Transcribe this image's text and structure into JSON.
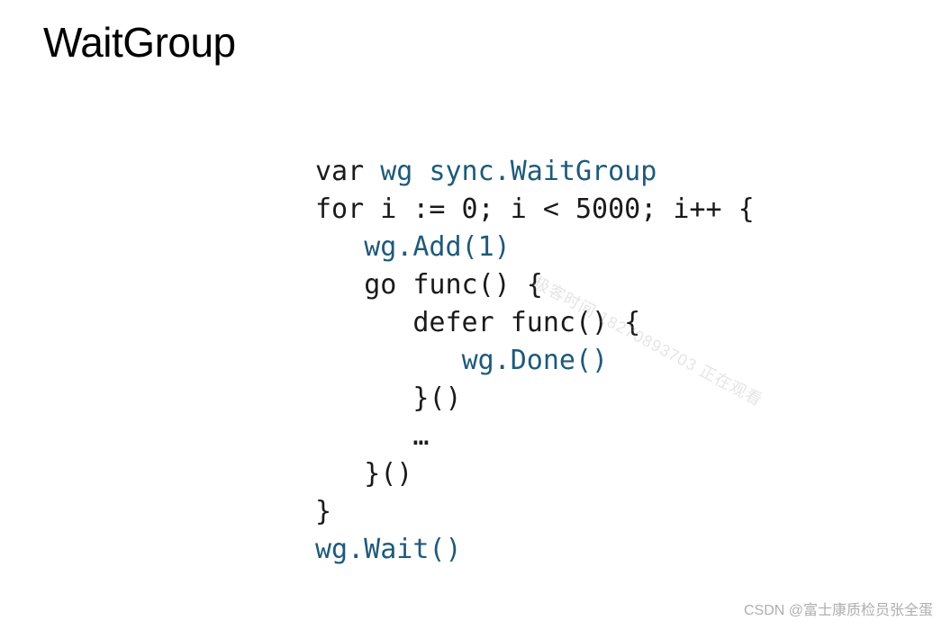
{
  "title": "WaitGroup",
  "code": {
    "line1_var": "var",
    "line1_wg": " wg ",
    "line1_type": "sync.WaitGroup",
    "line2": "for i := 0; i < 5000; i++ {",
    "line3_indent": "   ",
    "line3_call": "wg.Add(1)",
    "line4_indent": "   ",
    "line4_text": "go func() {",
    "line5_indent": "      ",
    "line5_text": "defer func() {",
    "line6_indent": "         ",
    "line6_call": "wg.Done()",
    "line7_indent": "      ",
    "line7_text": "}()",
    "line8_indent": "      ",
    "line8_text": "…",
    "line9_indent": "   ",
    "line9_text": "}()",
    "line10": "}",
    "line11": "wg.Wait()"
  },
  "watermark_diagonal": "极客时间 18270893703 正在观看",
  "watermark_bottom": "CSDN @富士康质检员张全蛋"
}
